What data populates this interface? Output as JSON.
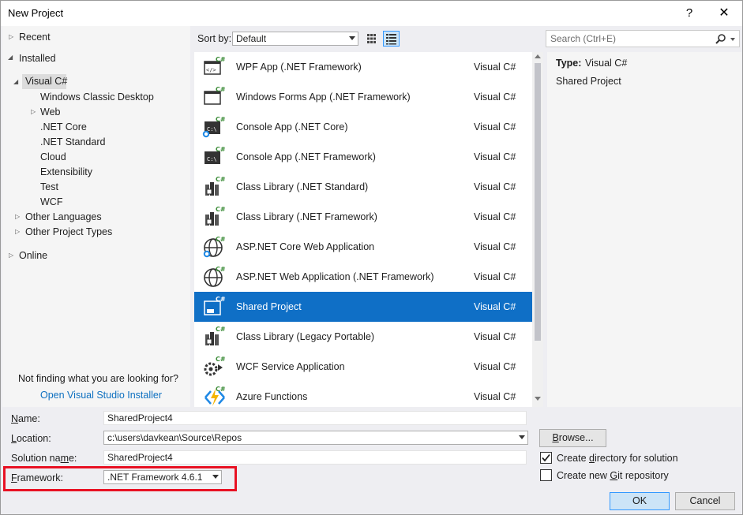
{
  "window": {
    "title": "New Project",
    "help_glyph": "?",
    "close_glyph": "✕"
  },
  "tree": {
    "recent": "Recent",
    "installed": "Installed",
    "visual_csharp": "Visual C#",
    "children": [
      "Windows Classic Desktop",
      "Web",
      ".NET Core",
      ".NET Standard",
      "Cloud",
      "Extensibility",
      "Test",
      "WCF"
    ],
    "other_languages": "Other Languages",
    "other_project_types": "Other Project Types",
    "online": "Online",
    "not_finding": "Not finding what you are looking for?",
    "installer_link": "Open Visual Studio Installer"
  },
  "sort": {
    "label": "Sort by:",
    "value": "Default"
  },
  "search": {
    "placeholder": "Search (Ctrl+E)"
  },
  "templates": [
    {
      "name": "WPF App (.NET Framework)",
      "lang": "Visual C#",
      "icon": "wpf-app-icon"
    },
    {
      "name": "Windows Forms App (.NET Framework)",
      "lang": "Visual C#",
      "icon": "windows-forms-icon"
    },
    {
      "name": "Console App (.NET Core)",
      "lang": "Visual C#",
      "icon": "console-core-icon"
    },
    {
      "name": "Console App (.NET Framework)",
      "lang": "Visual C#",
      "icon": "console-framework-icon"
    },
    {
      "name": "Class Library (.NET Standard)",
      "lang": "Visual C#",
      "icon": "class-library-icon"
    },
    {
      "name": "Class Library (.NET Framework)",
      "lang": "Visual C#",
      "icon": "class-library-icon"
    },
    {
      "name": "ASP.NET Core Web Application",
      "lang": "Visual C#",
      "icon": "globe-core-icon"
    },
    {
      "name": "ASP.NET Web Application (.NET Framework)",
      "lang": "Visual C#",
      "icon": "globe-icon"
    },
    {
      "name": "Shared Project",
      "lang": "Visual C#",
      "icon": "shared-project-icon"
    },
    {
      "name": "Class Library (Legacy Portable)",
      "lang": "Visual C#",
      "icon": "class-library-icon"
    },
    {
      "name": "WCF Service Application",
      "lang": "Visual C#",
      "icon": "wcf-service-icon"
    },
    {
      "name": "Azure Functions",
      "lang": "Visual C#",
      "icon": "azure-functions-icon"
    }
  ],
  "selected_template_index": 8,
  "details": {
    "type_label": "Type:",
    "type_value": "Visual C#",
    "description": "Shared Project"
  },
  "form": {
    "name_label": "Name:",
    "name_value": "SharedProject4",
    "location_label": "Location:",
    "location_value": "c:\\users\\davkean\\Source\\Repos",
    "solution_label": "Solution name:",
    "solution_value": "SharedProject4",
    "framework_label": "Framework:",
    "framework_value": ".NET Framework 4.6.1",
    "browse": "Browse...",
    "create_dir": "Create directory for solution",
    "create_dir_checked": true,
    "git_repo": "Create new Git repository",
    "git_repo_checked": false,
    "ok": "OK",
    "cancel": "Cancel"
  },
  "colors": {
    "selection": "#0f6fc6",
    "highlight_box": "#e81123",
    "link": "#0e70c0"
  }
}
